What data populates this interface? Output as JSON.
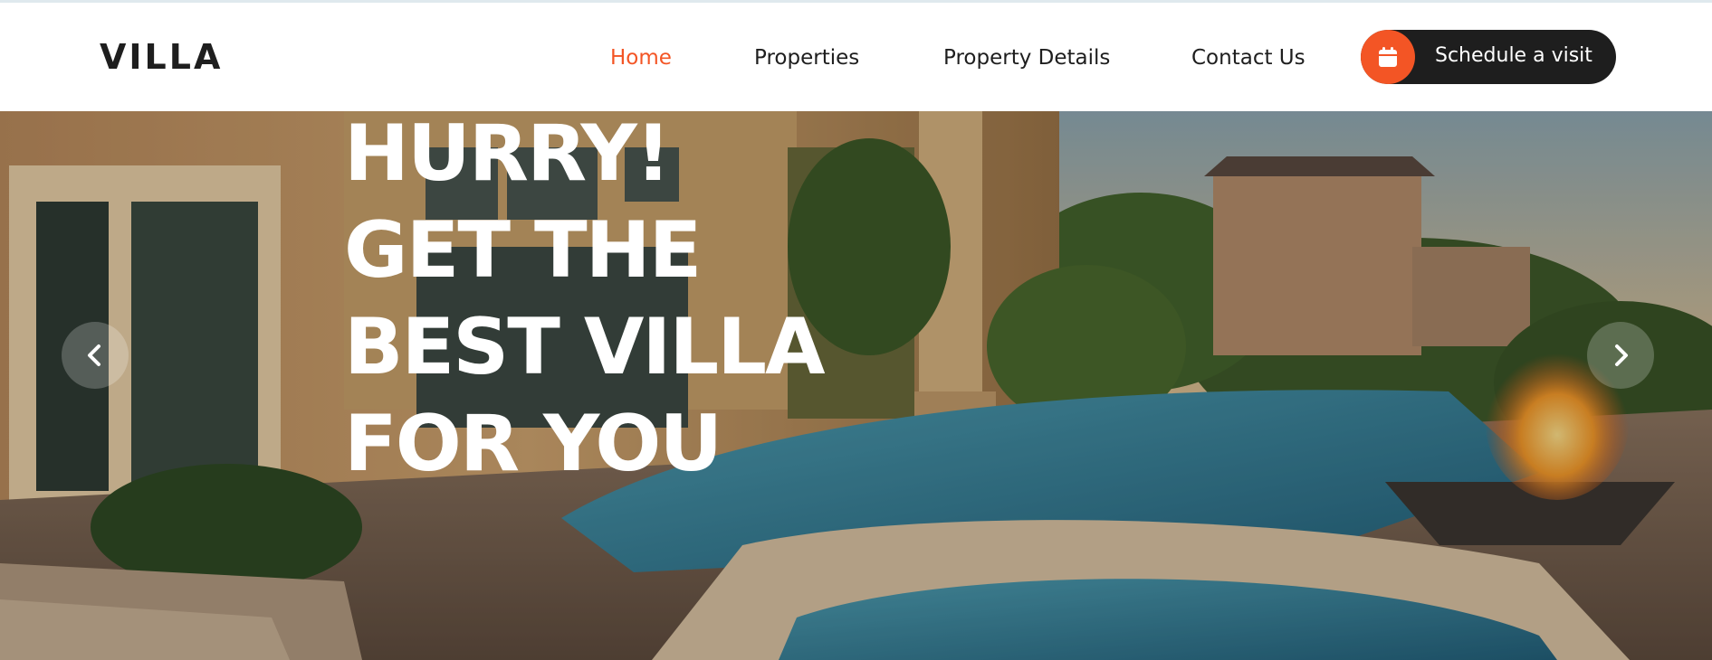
{
  "brand": {
    "logo": "VILLA"
  },
  "nav": {
    "items": [
      {
        "label": "Home",
        "active": true
      },
      {
        "label": "Properties",
        "active": false
      },
      {
        "label": "Property Details",
        "active": false
      },
      {
        "label": "Contact Us",
        "active": false
      }
    ],
    "cta": {
      "label": "Schedule a visit",
      "icon": "calendar-icon"
    }
  },
  "hero": {
    "headline": [
      "HURRY!",
      "GET THE",
      "BEST VILLA",
      "FOR YOU"
    ],
    "prev_icon": "chevron-left-icon",
    "next_icon": "chevron-right-icon"
  },
  "colors": {
    "accent": "#f35525",
    "dark": "#1e1e1e",
    "text_light": "#ffffff"
  }
}
